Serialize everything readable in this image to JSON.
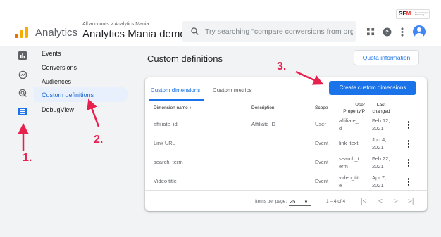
{
  "brand": {
    "app_name": "Analytics",
    "breadcrumb": "All accounts > Analytics Mania",
    "property_name": "Analytics Mania demo",
    "watermark": "SEMRush"
  },
  "search": {
    "placeholder": "Try searching \"compare conversions from organic..."
  },
  "sidebar": {
    "items": [
      {
        "label": "Events"
      },
      {
        "label": "Conversions"
      },
      {
        "label": "Audiences"
      },
      {
        "label": "Custom definitions",
        "active": true
      },
      {
        "label": "DebugView"
      }
    ]
  },
  "main": {
    "title": "Custom definitions",
    "quota_button": "Quota information",
    "create_button": "Create custom dimensions",
    "tabs": [
      {
        "label": "Custom dimensions",
        "active": true
      },
      {
        "label": "Custom metrics"
      }
    ],
    "columns": {
      "name": "Dimension name ↑",
      "description": "Description",
      "scope": "Scope",
      "user_prop_1": "User",
      "user_prop_2": "Property/P",
      "changed_1": "Last",
      "changed_2": "changed"
    },
    "rows": [
      {
        "name": "affiliate_id",
        "description": "Affiliate ID",
        "scope": "User",
        "prop_1": "affiliate_i",
        "prop_2": "d",
        "date_1": "Feb 12,",
        "date_2": "2021"
      },
      {
        "name": "Link URL",
        "description": "",
        "scope": "Event",
        "prop_1": "link_text",
        "prop_2": "",
        "date_1": "Jun 4,",
        "date_2": "2021"
      },
      {
        "name": "search_term",
        "description": "",
        "scope": "Event",
        "prop_1": "search_t",
        "prop_2": "erm",
        "date_1": "Feb 22,",
        "date_2": "2021"
      },
      {
        "name": "Video title",
        "description": "",
        "scope": "Event",
        "prop_1": "video_titl",
        "prop_2": "e",
        "date_1": "Apr 7,",
        "date_2": "2021"
      }
    ],
    "footer": {
      "items_per_page_label": "Items per page:",
      "items_per_page": "25",
      "range": "1 – 4 of 4"
    }
  },
  "annotations": {
    "step1": "1.",
    "step2": "2.",
    "step3": "3."
  },
  "colors": {
    "accent": "#1a73e8",
    "annotation": "#e8204d",
    "active_nav_bg": "#e8f0fe"
  },
  "icons": [
    "analytics-logo-icon",
    "search-icon",
    "apps-grid-icon",
    "help-icon",
    "more-vert-icon",
    "reports-icon",
    "explore-icon",
    "advertising-icon",
    "configure-icon",
    "sort-arrow-icon",
    "dropdown-caret-icon",
    "first-page-icon",
    "prev-page-icon",
    "next-page-icon",
    "last-page-icon"
  ]
}
